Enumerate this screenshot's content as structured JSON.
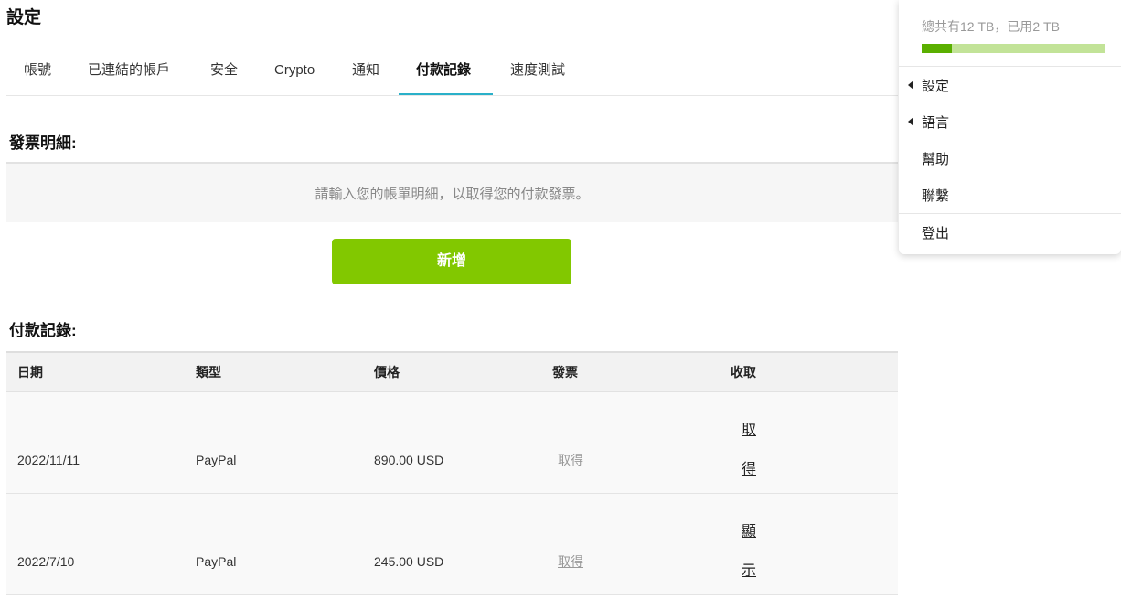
{
  "page": {
    "title": "設定"
  },
  "tabs": [
    {
      "label": "帳號"
    },
    {
      "label": "已連結的帳戶"
    },
    {
      "label": "安全"
    },
    {
      "label": "Crypto"
    },
    {
      "label": "通知"
    },
    {
      "label": "付款記錄",
      "active": true
    },
    {
      "label": "速度測試"
    }
  ],
  "invoice_details": {
    "heading": "發票明細:",
    "placeholder_text": "請輸入您的帳單明細，以取得您的付款發票。",
    "add_button_label": "新增",
    "add_button_color": "#82c800"
  },
  "payment_history": {
    "heading": "付款記錄:",
    "columns": [
      "日期",
      "類型",
      "價格",
      "發票",
      "收取"
    ],
    "rows": [
      {
        "date": "2022/11/11",
        "type": "PayPal",
        "price": "890.00 USD",
        "invoice": "取得",
        "receipt": [
          "取",
          "得"
        ]
      },
      {
        "date": "2022/7/10",
        "type": "PayPal",
        "price": "245.00 USD",
        "invoice": "取得",
        "receipt": [
          "顯",
          "示"
        ]
      }
    ]
  },
  "menu": {
    "storage_text": "總共有12 TB，已用2 TB",
    "storage_used_fraction": 0.1667,
    "storage_bar_color": "#c2e398",
    "storage_fill_color": "#5aaf00",
    "items": [
      {
        "label": "設定",
        "has_submenu": true
      },
      {
        "label": "語言",
        "has_submenu": true
      },
      {
        "label": "幫助",
        "has_submenu": false
      },
      {
        "label": "聯繫",
        "has_submenu": false
      },
      {
        "label": "登出",
        "has_submenu": false
      }
    ]
  },
  "accent_color": "#2ab0c9"
}
